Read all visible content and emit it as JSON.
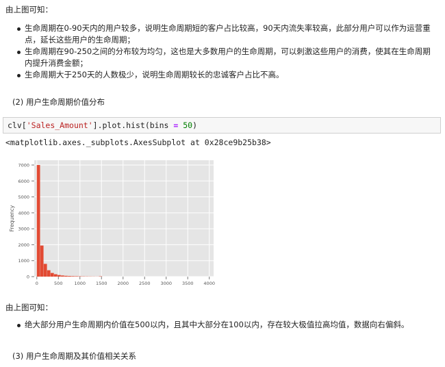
{
  "section1": {
    "intro": "由上图可知：",
    "bullets": [
      "生命周期在0-90天内的用户较多，说明生命周期短的客户占比较高，90天内流失率较高，此部分用户可以作为运营重点，延长这些用户的生命周期；",
      "生命周期在90-250之间的分布较为均匀，这也是大多数用户的生命周期，可以刺激这些用户的消费，使其在生命周期内提升消费金额；",
      "生命周期大于250天的人数极少，说明生命周期较长的忠诚客户占比不高。"
    ]
  },
  "heading2": "(2) 用户生命周期价值分布",
  "code_cell": {
    "var": "clv",
    "key": "'Sales_Amount'",
    "call": "].plot.hist(bins ",
    "op": "=",
    "num": "50",
    "close": ")"
  },
  "output_text": "<matplotlib.axes._subplots.AxesSubplot at 0x28ce9b25b38>",
  "section2": {
    "intro": "由上图可知：",
    "bullets": [
      "绝大部分用户生命周期内价值在500以内，且其中大部分在100以内，存在较大极值拉高均值，数据向右偏斜。"
    ]
  },
  "heading3": "(3) 用户生命周期及其价值相关关系",
  "colors": {
    "bar": "#e24a33",
    "plot_bg": "#e5e5e5",
    "grid": "#ffffff"
  },
  "chart_data": {
    "type": "bar",
    "title": "",
    "xlabel": "",
    "ylabel": "Frequency",
    "xlim": [
      -60,
      4100
    ],
    "ylim": [
      0,
      7300
    ],
    "xticks": [
      0,
      500,
      1000,
      1500,
      2000,
      2500,
      3000,
      3500,
      4000
    ],
    "yticks": [
      0,
      1000,
      2000,
      3000,
      4000,
      5000,
      6000,
      7000
    ],
    "bin_width": 80,
    "bin_starts": [
      0,
      80,
      160,
      240,
      320,
      400,
      480,
      560,
      640,
      720,
      800,
      880,
      960,
      1040,
      1120,
      1200,
      1280,
      1360,
      1440
    ],
    "values": [
      7000,
      1950,
      800,
      400,
      230,
      150,
      100,
      70,
      50,
      40,
      30,
      25,
      20,
      15,
      12,
      10,
      8,
      6,
      20
    ]
  }
}
